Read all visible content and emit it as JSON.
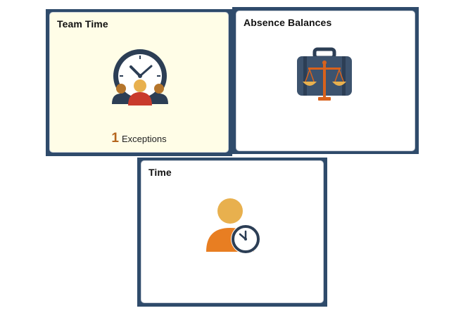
{
  "tiles": {
    "team_time": {
      "title": "Team Time",
      "count": "1",
      "count_label": "Exceptions",
      "icon": "team-clock-icon",
      "bg": "#fffde7"
    },
    "absence_balances": {
      "title": "Absence Balances",
      "icon": "briefcase-scale-icon",
      "bg": "#ffffff"
    },
    "time": {
      "title": "Time",
      "icon": "person-clock-icon",
      "bg": "#ffffff"
    }
  },
  "colors": {
    "frame": "#2f4b6b",
    "accent_orange": "#e87e22",
    "accent_gold": "#e8b04e",
    "icon_navy": "#2c3e55",
    "count_color": "#b5651d"
  }
}
